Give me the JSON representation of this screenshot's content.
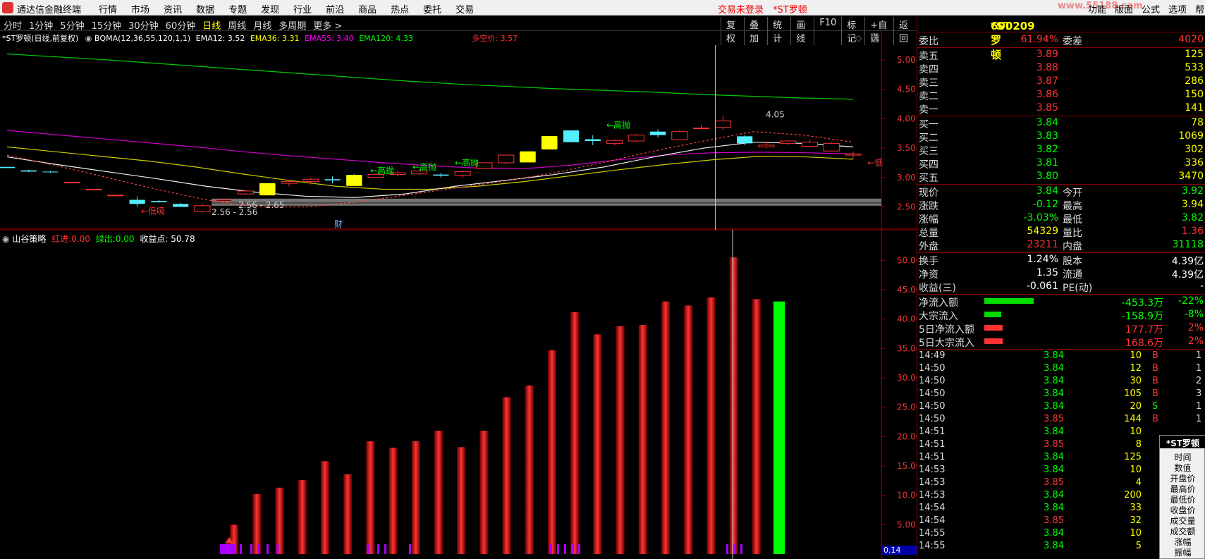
{
  "app": {
    "title": "通达信金融终端",
    "login_status": "交易未登录",
    "stock_tag": "*ST罗顿",
    "ad_text": "www.55188.com"
  },
  "menu": [
    "行情",
    "市场",
    "资讯",
    "数据",
    "专题",
    "发现",
    "行业",
    "前沿",
    "商品",
    "热点",
    "委托",
    "交易"
  ],
  "right_menu": [
    "功能",
    "版面",
    "公式",
    "选项",
    "帮"
  ],
  "periods": [
    {
      "label": "分时",
      "active": false
    },
    {
      "label": "1分钟",
      "active": false
    },
    {
      "label": "5分钟",
      "active": false
    },
    {
      "label": "15分钟",
      "active": false
    },
    {
      "label": "30分钟",
      "active": false
    },
    {
      "label": "60分钟",
      "active": false
    },
    {
      "label": "日线",
      "active": true
    },
    {
      "label": "周线",
      "active": false
    },
    {
      "label": "月线",
      "active": false
    },
    {
      "label": "多周期",
      "active": false
    },
    {
      "label": "更多 >",
      "active": false
    }
  ],
  "tools": [
    "复权",
    "叠加",
    "统计",
    "画线",
    "F10",
    "标记",
    "+自选",
    "返回"
  ],
  "kline": {
    "info_name": "*ST罗顿(日线,前复权)",
    "info_ind": "BQMA(12,36,55,120,1,1)",
    "ema12": "EMA12: 3.52",
    "ema36": "EMA36: 3.31",
    "ema55": "EMA55: 3.40",
    "ema120": "EMA120: 4.33",
    "duokong": "多空价: 3.57",
    "price_axis": [
      "5.00",
      "4.50",
      "4.00",
      "3.50",
      "3.00",
      "2.50"
    ],
    "y_range": [
      2.35,
      5.25
    ],
    "candles": [
      [
        3.18,
        3.18,
        3.16,
        3.16
      ],
      [
        3.12,
        3.13,
        3.09,
        3.1
      ],
      [
        3.1,
        3.11,
        3.08,
        3.09
      ],
      [
        2.92,
        2.93,
        2.91,
        2.92
      ],
      [
        2.8,
        2.81,
        2.79,
        2.8
      ],
      [
        2.7,
        2.71,
        2.69,
        2.7
      ],
      [
        2.62,
        2.68,
        2.5,
        2.55
      ],
      [
        2.6,
        2.62,
        2.57,
        2.58
      ],
      [
        2.55,
        2.57,
        2.5,
        2.5
      ],
      [
        2.42,
        2.55,
        2.4,
        2.52
      ],
      [
        2.6,
        2.64,
        2.56,
        2.62
      ],
      [
        2.72,
        2.78,
        2.7,
        2.77
      ],
      [
        2.72,
        2.9,
        2.7,
        2.88
      ],
      [
        2.9,
        2.94,
        2.85,
        2.93
      ],
      [
        2.93,
        3.0,
        2.88,
        2.97
      ],
      [
        2.97,
        3.02,
        2.9,
        2.95
      ],
      [
        3.02,
        3.06,
        2.88,
        2.88
      ],
      [
        3.0,
        3.08,
        3.0,
        3.05
      ],
      [
        3.05,
        3.1,
        3.02,
        3.08
      ],
      [
        3.06,
        3.14,
        3.04,
        3.11
      ],
      [
        3.05,
        3.08,
        3.0,
        3.03
      ],
      [
        3.04,
        3.12,
        3.0,
        3.1
      ],
      [
        3.15,
        3.26,
        3.14,
        3.25
      ],
      [
        3.25,
        3.4,
        3.22,
        3.38
      ],
      [
        3.28,
        3.42,
        3.28,
        3.42
      ],
      [
        3.5,
        3.7,
        3.5,
        3.68
      ],
      [
        3.8,
        3.8,
        3.6,
        3.6
      ],
      [
        3.65,
        3.72,
        3.55,
        3.62
      ],
      [
        3.58,
        3.65,
        3.55,
        3.63
      ],
      [
        3.62,
        3.74,
        3.6,
        3.72
      ],
      [
        3.78,
        3.82,
        3.68,
        3.72
      ],
      [
        3.64,
        3.8,
        3.64,
        3.78
      ],
      [
        3.84,
        3.9,
        3.82,
        3.84
      ],
      [
        3.85,
        4.05,
        3.8,
        3.96
      ],
      [
        3.7,
        3.72,
        3.55,
        3.58
      ],
      [
        3.52,
        3.6,
        3.5,
        3.55
      ],
      [
        3.58,
        3.64,
        3.55,
        3.62
      ],
      [
        3.53,
        3.64,
        3.53,
        3.6
      ],
      [
        3.45,
        3.6,
        3.44,
        3.58
      ],
      [
        3.38,
        3.44,
        3.32,
        3.4
      ]
    ],
    "labels": {
      "xishou": "←低吸",
      "gaopao": "←高抛",
      "range1": "2.56 - 2.65",
      "range2": "2.56 - 2.56",
      "peak": "4.05",
      "di_small": "←低",
      "cai": "财"
    }
  },
  "indicator": {
    "name": "山谷策略",
    "red_label": "红进:",
    "red_val": "0.00",
    "green_label": "绿出:",
    "green_val": "0.00",
    "profit_label": "收益点:",
    "profit_val": "50.78",
    "y_axis": [
      "50.00",
      "45.00",
      "40.00",
      "35.00",
      "30.00",
      "25.00",
      "20.00",
      "15.00",
      "10.00",
      "5.00"
    ],
    "y_range": [
      0,
      54
    ],
    "bars": [
      0,
      0,
      0,
      0,
      0,
      0,
      0,
      0,
      0,
      0,
      5,
      10.2,
      11.3,
      12.6,
      15.8,
      13.6,
      19.2,
      18.1,
      19.2,
      21.0,
      18.2,
      21.0,
      26.7,
      28.7,
      34.7,
      41.2,
      37.4,
      38.8,
      39.0,
      43.0,
      42.3,
      43.7,
      50.5,
      43.4,
      43.0
    ],
    "bottom_value": "0.14"
  },
  "side": {
    "code": "600209",
    "name": "*ST罗顿",
    "weibi": {
      "label": "委比",
      "value": "61.94%",
      "label2": "委差",
      "value2": "4020"
    },
    "asks": [
      {
        "label": "卖五",
        "price": "3.89",
        "vol": "125"
      },
      {
        "label": "卖四",
        "price": "3.88",
        "vol": "533"
      },
      {
        "label": "卖三",
        "price": "3.87",
        "vol": "286"
      },
      {
        "label": "卖二",
        "price": "3.86",
        "vol": "150"
      },
      {
        "label": "卖一",
        "price": "3.85",
        "vol": "141"
      }
    ],
    "bids": [
      {
        "label": "买一",
        "price": "3.84",
        "vol": "78"
      },
      {
        "label": "买二",
        "price": "3.83",
        "vol": "1069"
      },
      {
        "label": "买三",
        "price": "3.82",
        "vol": "302"
      },
      {
        "label": "买四",
        "price": "3.81",
        "vol": "336"
      },
      {
        "label": "买五",
        "price": "3.80",
        "vol": "3470"
      }
    ],
    "quote": [
      {
        "l1": "现价",
        "v1": "3.84",
        "c1": "green",
        "l2": "今开",
        "v2": "3.92",
        "c2": "green"
      },
      {
        "l1": "涨跌",
        "v1": "-0.12",
        "c1": "green",
        "l2": "最高",
        "v2": "3.94",
        "c2": "yel"
      },
      {
        "l1": "涨幅",
        "v1": "-3.03%",
        "c1": "green",
        "l2": "最低",
        "v2": "3.82",
        "c2": "green"
      },
      {
        "l1": "总量",
        "v1": "54329",
        "c1": "yel",
        "l2": "量比",
        "v2": "1.36",
        "c2": "red"
      },
      {
        "l1": "外盘",
        "v1": "23211",
        "c1": "red",
        "l2": "内盘",
        "v2": "31118",
        "c2": "green"
      }
    ],
    "fund": [
      {
        "l1": "换手",
        "v1": "1.24%",
        "l2": "股本",
        "v2": "4.39亿"
      },
      {
        "l1": "净资",
        "v1": "1.35",
        "l2": "流通",
        "v2": "4.39亿"
      },
      {
        "l1": "收益(三)",
        "v1": "-0.061",
        "l2": "PE(动)",
        "v2": "-"
      }
    ],
    "flows": [
      {
        "label": "净流入额",
        "value": "-453.3万",
        "pct": "-22%",
        "color": "#0d0",
        "len": 70,
        "cls": "green"
      },
      {
        "label": "大宗流入",
        "value": "-158.9万",
        "pct": "-8%",
        "color": "#0d0",
        "len": 24,
        "cls": "green"
      },
      {
        "label": "5日净流入额",
        "value": "177.7万",
        "pct": "2%",
        "color": "#f33",
        "len": 26,
        "cls": "red"
      },
      {
        "label": "5日大宗流入",
        "value": "168.6万",
        "pct": "2%",
        "color": "#f33",
        "len": 26,
        "cls": "red"
      }
    ],
    "ticks": [
      {
        "t": "14:49",
        "p": "3.84",
        "v": "10",
        "f": "B",
        "n": "1"
      },
      {
        "t": "14:50",
        "p": "3.84",
        "v": "12",
        "f": "B",
        "n": "1"
      },
      {
        "t": "14:50",
        "p": "3.84",
        "v": "30",
        "f": "B",
        "n": "2"
      },
      {
        "t": "14:50",
        "p": "3.84",
        "v": "105",
        "f": "B",
        "n": "3"
      },
      {
        "t": "14:50",
        "p": "3.84",
        "v": "20",
        "f": "S",
        "n": "1"
      },
      {
        "t": "14:50",
        "p": "3.85",
        "v": "144",
        "f": "B",
        "n": "1"
      },
      {
        "t": "14:51",
        "p": "3.84",
        "v": "10",
        "f": "",
        "n": ""
      },
      {
        "t": "14:51",
        "p": "3.85",
        "v": "8",
        "f": "",
        "n": ""
      },
      {
        "t": "14:51",
        "p": "3.84",
        "v": "125",
        "f": "",
        "n": ""
      },
      {
        "t": "14:53",
        "p": "3.84",
        "v": "10",
        "f": "",
        "n": ""
      },
      {
        "t": "14:53",
        "p": "3.85",
        "v": "4",
        "f": "",
        "n": ""
      },
      {
        "t": "14:53",
        "p": "3.84",
        "v": "200",
        "f": "",
        "n": ""
      },
      {
        "t": "14:54",
        "p": "3.84",
        "v": "33",
        "f": "",
        "n": ""
      },
      {
        "t": "14:54",
        "p": "3.85",
        "v": "32",
        "f": "",
        "n": ""
      },
      {
        "t": "14:55",
        "p": "3.84",
        "v": "10",
        "f": "",
        "n": ""
      },
      {
        "t": "14:55",
        "p": "3.84",
        "v": "5",
        "f": "",
        "n": ""
      }
    ]
  },
  "popup": {
    "title": "*ST罗顿",
    "items": [
      "时间",
      "数值",
      "开盘价",
      "最高价",
      "最低价",
      "收盘价",
      "成交量",
      "成交额",
      "涨幅",
      "振幅"
    ]
  }
}
